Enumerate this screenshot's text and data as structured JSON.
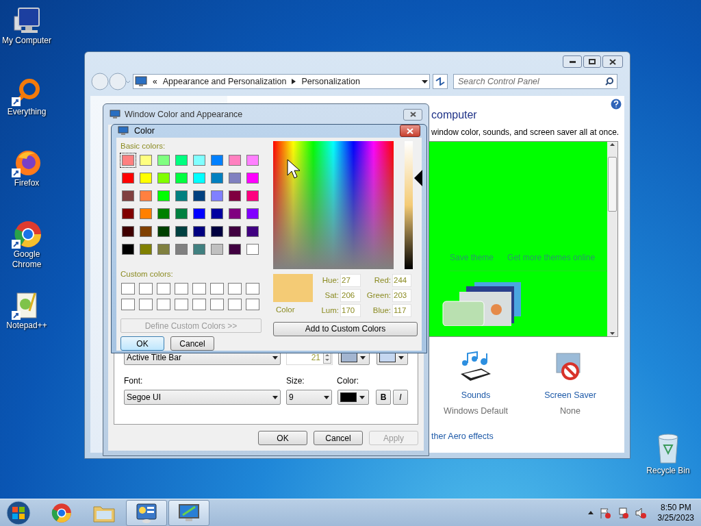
{
  "desktop_icons": [
    {
      "label": "My Computer",
      "kind": "computer"
    },
    {
      "label": "Everything",
      "kind": "everything"
    },
    {
      "label": "Firefox",
      "kind": "firefox"
    },
    {
      "label": "Google Chrome",
      "kind": "chrome"
    },
    {
      "label": "Notepad++",
      "kind": "notepad"
    }
  ],
  "recycle_bin": {
    "label": "Recycle Bin"
  },
  "control_panel": {
    "address_prefix": "«",
    "breadcrumb": [
      "Appearance and Personalization",
      "Personalization"
    ],
    "search": {
      "placeholder": "Search Control Panel"
    },
    "heading": "computer",
    "subtitle": "window color, sounds, and screen saver all at once.",
    "theme_links": [
      "Save theme",
      "Get more themes online"
    ],
    "items": [
      {
        "title": "Sounds",
        "value": "Windows Default",
        "kind": "sounds"
      },
      {
        "title": "Screen Saver",
        "value": "None",
        "kind": "screensaver"
      }
    ],
    "aero_link": "ther Aero effects"
  },
  "window_color": {
    "title": "Window Color and Appearance",
    "item": "Active Title Bar",
    "item_size": "21",
    "item_colors": [
      {
        "color": "#a3b5d0"
      },
      {
        "color": "#c5d7f0"
      }
    ],
    "font_label": "Font:",
    "font": "Segoe UI",
    "size_label": "Size:",
    "size": "9",
    "color_label": "Color:",
    "font_colors": [
      {
        "color": "#000000"
      }
    ],
    "bold": "B",
    "italic": "I",
    "bold_on": false,
    "italic_on": false,
    "buttons": [
      {
        "label": "OK",
        "disabled": false
      },
      {
        "label": "Cancel",
        "disabled": false
      },
      {
        "label": "Apply",
        "disabled": true
      }
    ]
  },
  "color_dialog": {
    "title": "Color",
    "basic_label": "Basic colors:",
    "basic_colors": [
      {
        "color": "#ff8080",
        "selected": true
      },
      {
        "color": "#ffff80",
        "selected": false
      },
      {
        "color": "#80ff80",
        "selected": false
      },
      {
        "color": "#00ff80",
        "selected": false
      },
      {
        "color": "#80ffff",
        "selected": false
      },
      {
        "color": "#0080ff",
        "selected": false
      },
      {
        "color": "#ff80c0",
        "selected": false
      },
      {
        "color": "#ff80ff",
        "selected": false
      },
      {
        "color": "#ff0000",
        "selected": false
      },
      {
        "color": "#ffff00",
        "selected": false
      },
      {
        "color": "#80ff00",
        "selected": false
      },
      {
        "color": "#00ff40",
        "selected": false
      },
      {
        "color": "#00ffff",
        "selected": false
      },
      {
        "color": "#0080c0",
        "selected": false
      },
      {
        "color": "#8080c0",
        "selected": false
      },
      {
        "color": "#ff00ff",
        "selected": false
      },
      {
        "color": "#804040",
        "selected": false
      },
      {
        "color": "#ff8040",
        "selected": false
      },
      {
        "color": "#00ff00",
        "selected": false
      },
      {
        "color": "#008080",
        "selected": false
      },
      {
        "color": "#004080",
        "selected": false
      },
      {
        "color": "#8080ff",
        "selected": false
      },
      {
        "color": "#800040",
        "selected": false
      },
      {
        "color": "#ff0080",
        "selected": false
      },
      {
        "color": "#800000",
        "selected": false
      },
      {
        "color": "#ff8000",
        "selected": false
      },
      {
        "color": "#008000",
        "selected": false
      },
      {
        "color": "#008040",
        "selected": false
      },
      {
        "color": "#0000ff",
        "selected": false
      },
      {
        "color": "#0000a0",
        "selected": false
      },
      {
        "color": "#800080",
        "selected": false
      },
      {
        "color": "#8000ff",
        "selected": false
      },
      {
        "color": "#400000",
        "selected": false
      },
      {
        "color": "#804000",
        "selected": false
      },
      {
        "color": "#004000",
        "selected": false
      },
      {
        "color": "#004040",
        "selected": false
      },
      {
        "color": "#000080",
        "selected": false
      },
      {
        "color": "#000040",
        "selected": false
      },
      {
        "color": "#400040",
        "selected": false
      },
      {
        "color": "#400080",
        "selected": false
      },
      {
        "color": "#000000",
        "selected": false
      },
      {
        "color": "#808000",
        "selected": false
      },
      {
        "color": "#808040",
        "selected": false
      },
      {
        "color": "#808080",
        "selected": false
      },
      {
        "color": "#408080",
        "selected": false
      },
      {
        "color": "#c0c0c0",
        "selected": false
      },
      {
        "color": "#400040",
        "selected": false
      },
      {
        "color": "#ffffff",
        "selected": false
      }
    ],
    "custom_label": "Custom colors:",
    "custom_colors": [
      {
        "color": "#ffffff"
      },
      {
        "color": "#ffffff"
      },
      {
        "color": "#ffffff"
      },
      {
        "color": "#ffffff"
      },
      {
        "color": "#ffffff"
      },
      {
        "color": "#ffffff"
      },
      {
        "color": "#ffffff"
      },
      {
        "color": "#ffffff"
      },
      {
        "color": "#ffffff"
      },
      {
        "color": "#ffffff"
      },
      {
        "color": "#ffffff"
      },
      {
        "color": "#ffffff"
      },
      {
        "color": "#ffffff"
      },
      {
        "color": "#ffffff"
      },
      {
        "color": "#ffffff"
      },
      {
        "color": "#ffffff"
      }
    ],
    "define_button": {
      "label": "Define Custom Colors >>",
      "disabled": true
    },
    "ok": "OK",
    "cancel": "Cancel",
    "add_button": "Add to Custom Colors",
    "current": {
      "color": "#f4cb75"
    },
    "current_label": "Color",
    "luminance": {
      "level": 0.71
    },
    "fields": [
      {
        "label": "Hue:",
        "value": "27"
      },
      {
        "label": "Red:",
        "value": "244"
      },
      {
        "label": "Sat:",
        "value": "206"
      },
      {
        "label": "Green:",
        "value": "203"
      },
      {
        "label": "Lum:",
        "value": "170"
      },
      {
        "label": "Blue:",
        "value": "117"
      }
    ]
  },
  "taskbar": {
    "apps": [
      {
        "kind": "chrome",
        "active": false
      },
      {
        "kind": "explorer",
        "active": false
      },
      {
        "kind": "control-panel",
        "active": true
      },
      {
        "kind": "personalization",
        "active": true
      }
    ],
    "time": "8:50 PM",
    "date": "3/25/2023"
  }
}
